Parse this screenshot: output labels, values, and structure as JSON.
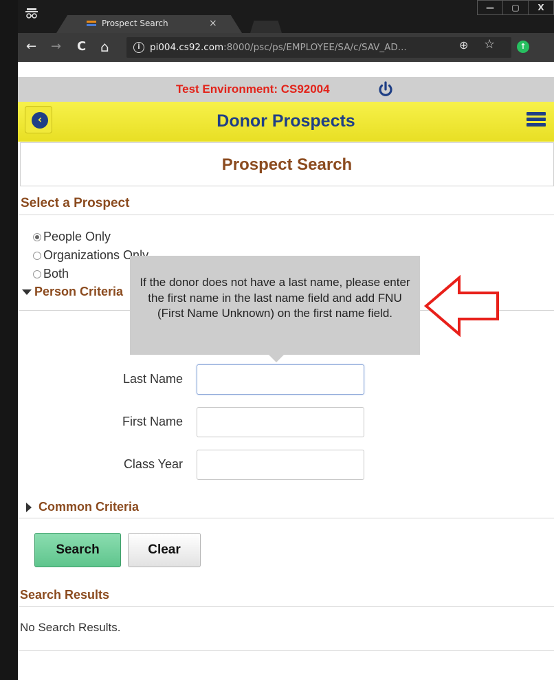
{
  "browser": {
    "tab_title": "Prospect Search",
    "tab_close": "×",
    "window_buttons": [
      "—",
      "▢",
      "X"
    ],
    "incognito_icon": "incognito-icon",
    "url_host": "pi004.cs92.com",
    "url_rest": ":8000/psc/ps/EMPLOYEE/SA/c/SAV_AD...",
    "nav_back": "←",
    "nav_forward": "→",
    "nav_reload": "C",
    "nav_home": "⌂",
    "info": "i",
    "zoom": "⊕",
    "star": "☆",
    "ext": "↑"
  },
  "env_banner": {
    "text": "Test Environment: CS92004",
    "color": "#e2231a"
  },
  "header": {
    "title": "Donor Prospects",
    "back_glyph": "‹"
  },
  "page": {
    "title": "Prospect Search"
  },
  "select_prospect": {
    "heading": "Select a Prospect",
    "options": [
      {
        "label": "People Only",
        "selected": true
      },
      {
        "label": "Organizations Only",
        "selected": false
      },
      {
        "label": "Both",
        "selected": false
      }
    ]
  },
  "person_criteria": {
    "heading": "Person Criteria",
    "fields": [
      {
        "label": "Last Name",
        "value": ""
      },
      {
        "label": "First Name",
        "value": ""
      },
      {
        "label": "Class Year",
        "value": ""
      }
    ]
  },
  "common_criteria": {
    "heading": "Common Criteria"
  },
  "actions": {
    "search": "Search",
    "clear": "Clear"
  },
  "results": {
    "heading": "Search Results",
    "empty_text": "No Search Results."
  },
  "tooltip": {
    "text": "If the donor does not have a last name, please enter the first name in the last name field and add FNU (First Name Unknown) on the first name field."
  },
  "colors": {
    "header_yellow": "#f7f14a",
    "brand_blue": "#1f3f86",
    "section_brown": "#8b4b1f",
    "search_green": "#5fc58d",
    "annotation_red": "#e8201a"
  }
}
